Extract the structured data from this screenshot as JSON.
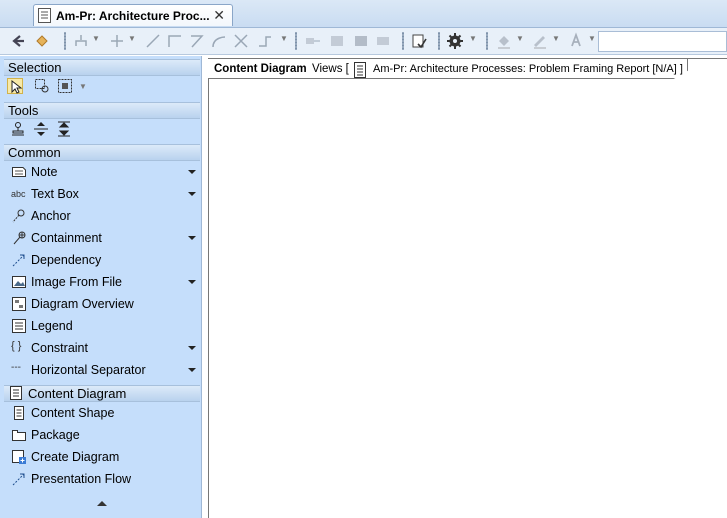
{
  "tab": {
    "title": "Am-Pr: Architecture Proc...",
    "close": "✕"
  },
  "toolbar": {
    "buttons": [
      "back-icon",
      "forward-icon",
      "tree-layout-icon",
      "ortho-layout-icon",
      "line-icon",
      "rect-path-icon",
      "path-icon",
      "curve-icon",
      "crossing-icon",
      "route-icon",
      "arrange-icon",
      "align-icon",
      "layout-icon",
      "layout2-icon",
      "validate-icon",
      "settings-icon",
      "fill-color-icon",
      "line-color-icon",
      "font-color-icon"
    ]
  },
  "palette": {
    "sections": {
      "selection": "Selection",
      "tools": "Tools",
      "common": "Common",
      "content_diagram": "Content Diagram"
    },
    "common_items": [
      {
        "label": "Note",
        "icon": "note-icon",
        "dropdown": true
      },
      {
        "label": "Text Box",
        "icon": "text-box-icon",
        "dropdown": true
      },
      {
        "label": "Anchor",
        "icon": "anchor-icon",
        "dropdown": false
      },
      {
        "label": "Containment",
        "icon": "containment-icon",
        "dropdown": true
      },
      {
        "label": "Dependency",
        "icon": "dependency-icon",
        "dropdown": false
      },
      {
        "label": "Image From File",
        "icon": "image-icon",
        "dropdown": true
      },
      {
        "label": "Diagram Overview",
        "icon": "diagram-overview-icon",
        "dropdown": false
      },
      {
        "label": "Legend",
        "icon": "legend-icon",
        "dropdown": false
      },
      {
        "label": "Constraint",
        "icon": "constraint-icon",
        "dropdown": true
      },
      {
        "label": "Horizontal Separator",
        "icon": "separator-icon",
        "dropdown": true
      }
    ],
    "content_items": [
      {
        "label": "Content Shape",
        "icon": "content-shape-icon"
      },
      {
        "label": "Package",
        "icon": "package-icon"
      },
      {
        "label": "Create Diagram",
        "icon": "create-diagram-icon"
      },
      {
        "label": "Presentation Flow",
        "icon": "presentation-flow-icon"
      }
    ],
    "text_box_abc": "abc",
    "constraint_braces": "{ }",
    "separator_dashes": "---"
  },
  "diagram": {
    "type_label": "Content Diagram",
    "views_label": "Views [",
    "name": "Am-Pr: Architecture Processes: Problem Framing Report [N/A] ]"
  },
  "colors": {
    "palette_bg": "#c5defb",
    "section_bg": "#c9dcf2",
    "toolbar_bg": "#e8f0f9"
  }
}
